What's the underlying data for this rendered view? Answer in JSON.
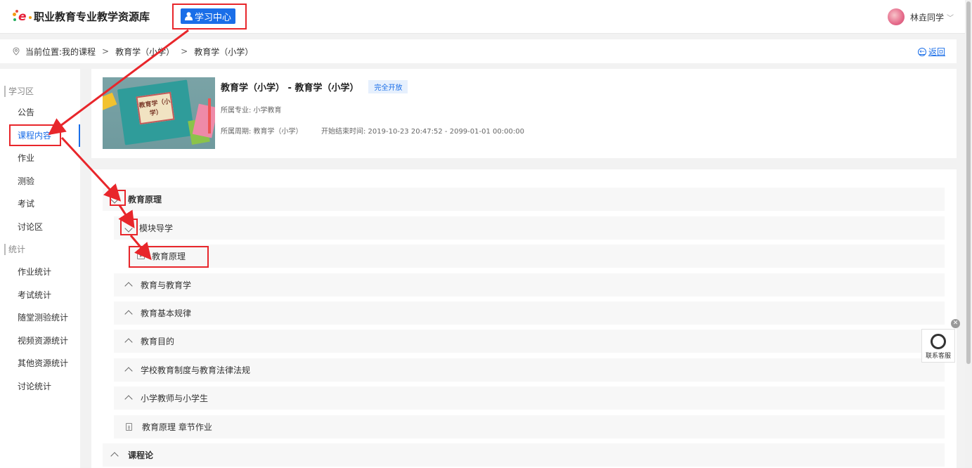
{
  "header": {
    "logo_text": "职业教育专业教学资源库",
    "study_center_label": "学习中心",
    "user_name": "林垚同学"
  },
  "breadcrumb": {
    "items": [
      "当前位置:我的课程",
      "教育学（小学）",
      "教育学（小学）"
    ],
    "back_label": "返回"
  },
  "sidebar": {
    "group_study": "学习区",
    "study_items": [
      "公告",
      "课程内容",
      "作业",
      "测验",
      "考试",
      "讨论区"
    ],
    "group_stats": "统计",
    "stats_items": [
      "作业统计",
      "考试统计",
      "随堂测验统计",
      "视频资源统计",
      "其他资源统计",
      "讨论统计"
    ],
    "active_item": "课程内容"
  },
  "course": {
    "title": "教育学（小学） - 教育学（小学）",
    "badge": "完全开放",
    "major": "所属专业: 小学教育",
    "cycle": "所属周期: 教育学（小学）",
    "time": "开始结束时间: 2019-10-23 20:47:52 - 2099-01-01 00:00:00",
    "thumb_text": "教育学（小学）"
  },
  "tree": {
    "chapter1": "教育原理",
    "module1": "模块导学",
    "lesson1": "教育原理",
    "sections": [
      "教育与教育学",
      "教育基本规律",
      "教育目的",
      "学校教育制度与教育法律法规",
      "小学教师与小学生"
    ],
    "homework": "教育原理 章节作业",
    "chapter2": "课程论"
  },
  "support": {
    "label": "联系客服"
  },
  "colors": {
    "accent": "#1a6ee8",
    "highlight": "#e8262b"
  }
}
